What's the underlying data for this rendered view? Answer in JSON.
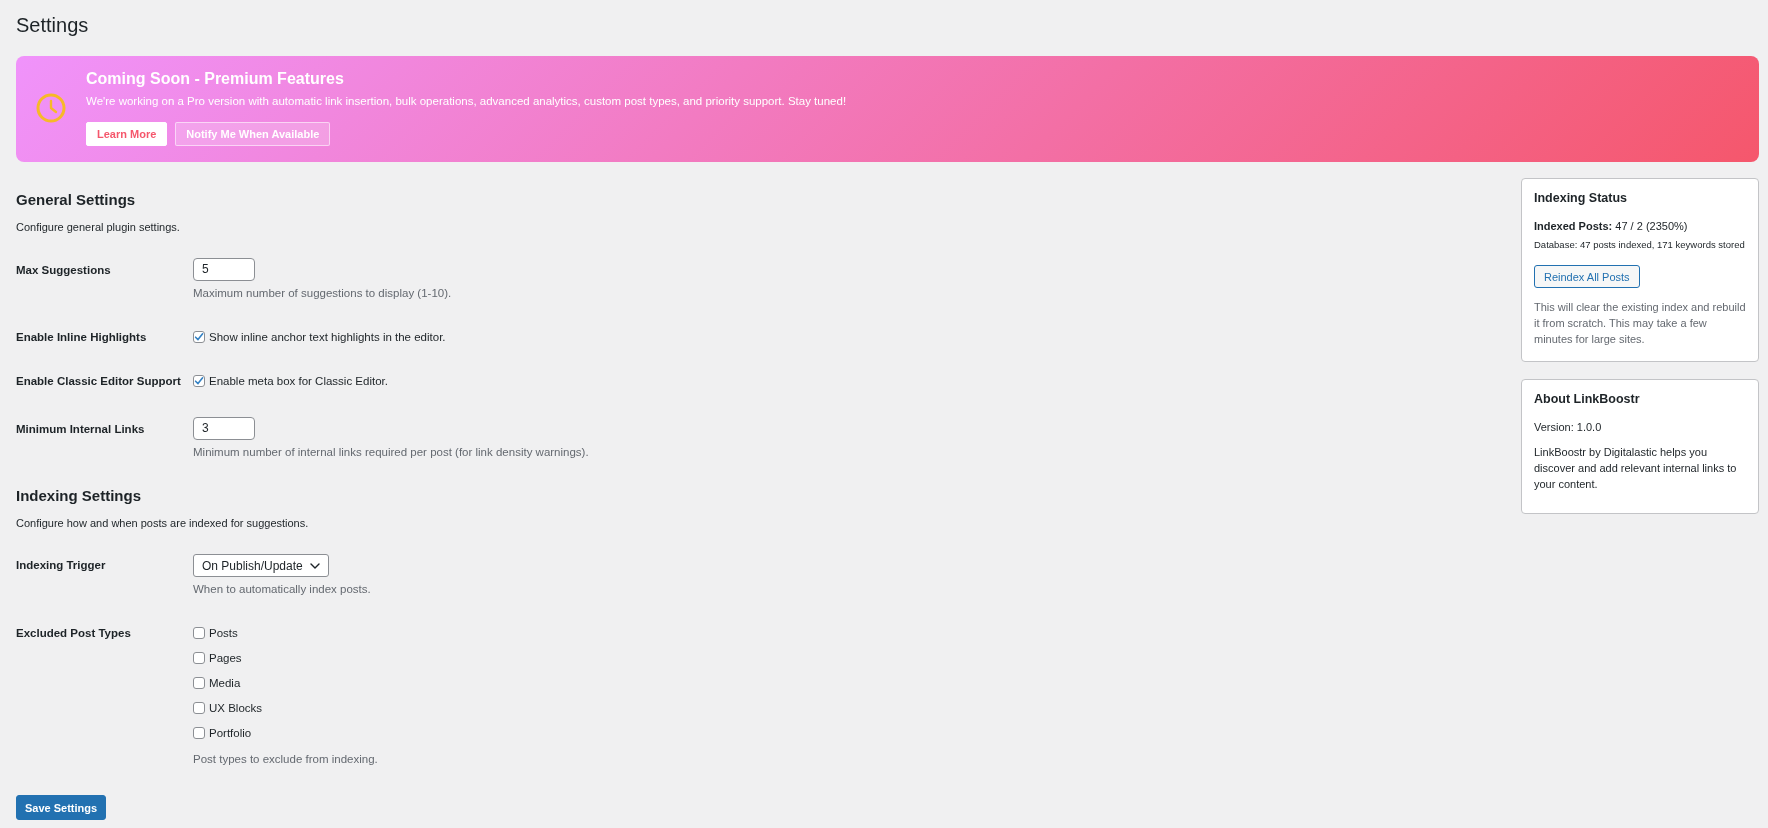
{
  "page": {
    "title": "Settings"
  },
  "banner": {
    "title": "Coming Soon - Premium Features",
    "description": "We're working on a Pro version with automatic link insertion, bulk operations, advanced analytics, custom post types, and priority support. Stay tuned!",
    "buttons": [
      {
        "label": "Learn More",
        "kind": "primary"
      },
      {
        "label": "Notify Me When Available",
        "kind": "secondary"
      }
    ]
  },
  "sections": [
    {
      "heading": "General Settings",
      "description": "Configure general plugin settings.",
      "fields": [
        {
          "kind": "number",
          "label": "Max Suggestions",
          "value": "5",
          "hint": "Maximum number of suggestions to display (1-10)."
        },
        {
          "kind": "checkbox",
          "label": "Enable Inline Highlights",
          "option": "Show inline anchor text highlights in the editor.",
          "checked": true
        },
        {
          "kind": "checkbox",
          "label": "Enable Classic Editor Support",
          "option": "Enable meta box for Classic Editor.",
          "checked": true
        },
        {
          "kind": "number",
          "label": "Minimum Internal Links",
          "value": "3",
          "hint": "Minimum number of internal links required per post (for link density warnings)."
        }
      ]
    },
    {
      "heading": "Indexing Settings",
      "description": "Configure how and when posts are indexed for suggestions.",
      "fields": [
        {
          "kind": "select",
          "label": "Indexing Trigger",
          "value": "On Publish/Update",
          "hint": "When to automatically index posts."
        },
        {
          "kind": "checkbox_group",
          "label": "Excluded Post Types",
          "options": [
            {
              "label": "Posts",
              "checked": false
            },
            {
              "label": "Pages",
              "checked": false
            },
            {
              "label": "Media",
              "checked": false
            },
            {
              "label": "UX Blocks",
              "checked": false
            },
            {
              "label": "Portfolio",
              "checked": false
            }
          ],
          "hint": "Post types to exclude from indexing."
        }
      ]
    }
  ],
  "save_button": {
    "label": "Save Settings"
  },
  "sidebar": {
    "cards": [
      {
        "title": "Indexing Status",
        "items": [
          {
            "kind": "stat",
            "text": "**Indexed Posts:** 47 / 2 (2350%)"
          },
          {
            "kind": "small",
            "text": "Database: 47 posts indexed, 171 keywords stored"
          },
          {
            "kind": "button",
            "label": "Reindex All Posts"
          },
          {
            "kind": "note",
            "text": "This will clear the existing index and rebuild it from scratch. This may take a few minutes for large sites."
          }
        ]
      },
      {
        "title": "About LinkBoostr",
        "items": [
          {
            "kind": "stat",
            "text": "Version: 1.0.0"
          },
          {
            "kind": "text",
            "text": "LinkBoostr by Digitalastic helps you discover and add relevant internal links to your content."
          }
        ]
      }
    ]
  }
}
